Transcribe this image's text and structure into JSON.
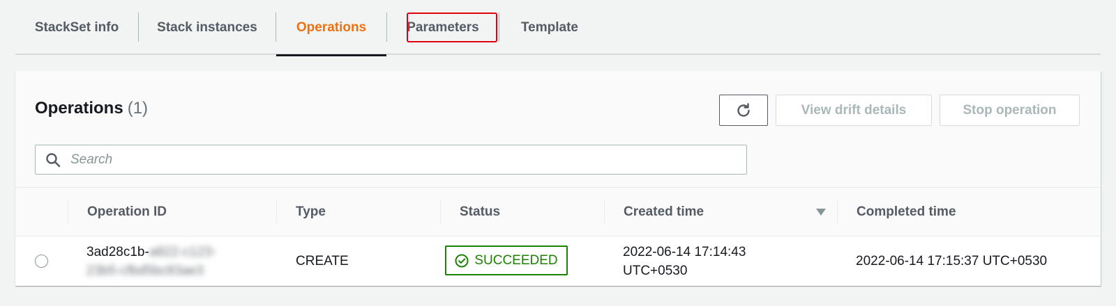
{
  "tabs": [
    {
      "label": "StackSet info"
    },
    {
      "label": "Stack instances"
    },
    {
      "label": "Operations",
      "active": true
    },
    {
      "label": "Parameters",
      "highlighted": true
    },
    {
      "label": "Template"
    }
  ],
  "panel": {
    "title": "Operations",
    "count": "(1)",
    "buttons": {
      "refresh_icon": "refresh-icon",
      "view_drift": "View drift details",
      "stop_operation": "Stop operation"
    },
    "search": {
      "placeholder": "Search",
      "value": ""
    }
  },
  "table": {
    "columns": [
      "Operation ID",
      "Type",
      "Status",
      "Created time",
      "Completed time"
    ],
    "rows": [
      {
        "operation_id_visible": "3ad28c1b-",
        "operation_id_blurred_1": "a822-c123-",
        "operation_id_blurred_2": "23b5-cfbd5bc83ae3",
        "type": "CREATE",
        "status": "SUCCEEDED",
        "created_line1": "2022-06-14 17:14:43",
        "created_line2": "UTC+0530",
        "completed": "2022-06-14 17:15:37 UTC+0530"
      }
    ]
  },
  "colors": {
    "accent": "#ec7211",
    "success": "#1d8102",
    "highlight": "#e0000f"
  }
}
